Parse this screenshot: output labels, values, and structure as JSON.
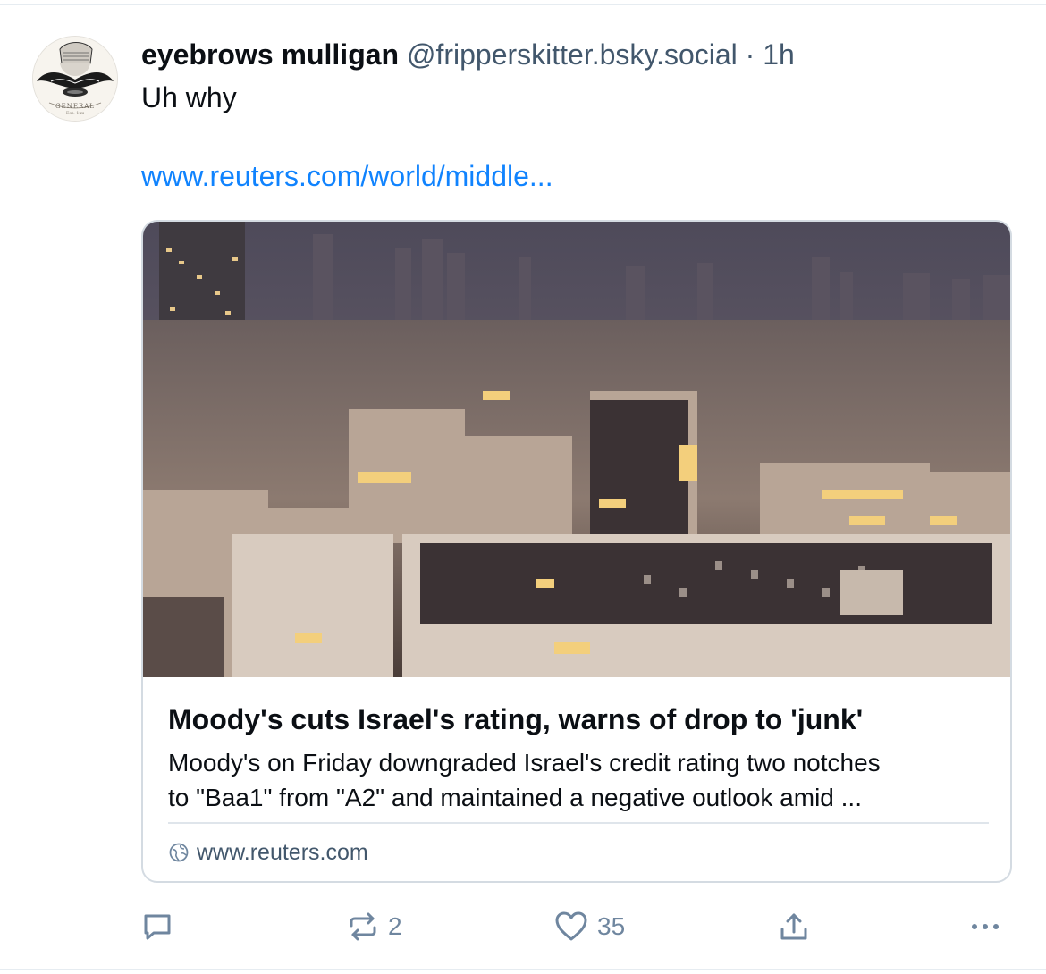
{
  "post": {
    "author_name": "eyebrows mulligan",
    "handle": "@fripperskitter.bsky.social",
    "separator": "·",
    "time": "1h",
    "text": "Uh why",
    "link_text": "www.reuters.com/world/middle..."
  },
  "avatar": {
    "label_top": "GENERAL",
    "label_bottom": "Est. 1xx"
  },
  "card": {
    "image_icon": "city-skyline-photo",
    "title": "Moody's cuts Israel's rating, warns of drop to 'junk'",
    "description_line1": "Moody's on Friday downgraded Israel's credit rating two notches",
    "description_line2": "to \"Baa1\" from \"A2\" and maintained a negative outlook amid ...",
    "domain": "www.reuters.com",
    "domain_icon": "globe-icon"
  },
  "actions": {
    "reply_icon": "reply-icon",
    "repost_icon": "repost-icon",
    "repost_count": "2",
    "like_icon": "heart-icon",
    "like_count": "35",
    "share_icon": "share-icon",
    "more_icon": "more-icon"
  },
  "colors": {
    "link": "#1083fe",
    "muted": "#42576c",
    "action": "#6f869f",
    "border": "#d4dbe2"
  }
}
